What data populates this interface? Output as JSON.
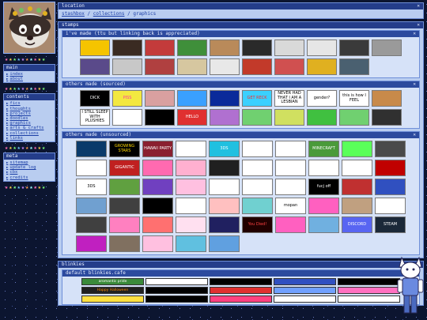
{
  "sidebar": {
    "sections": [
      {
        "title": "main",
        "items": [
          "index",
          "about"
        ]
      },
      {
        "title": "contents",
        "items": [
          "fics",
          "thoughts",
          "projects",
          "doodles",
          "graphics",
          "arts & crafts",
          "collections",
          "links"
        ]
      },
      {
        "title": "meta",
        "items": [
          "sitemap",
          "update log",
          "cbx",
          "credits"
        ]
      }
    ],
    "star_colors": [
      "#ff6fb5",
      "#ffd24a",
      "#7dff7a",
      "#6fc8ff",
      "#c98bff",
      "#ff9a4a",
      "#9affff",
      "#ff6fb5",
      "#ffd24a",
      "#7dff7a"
    ]
  },
  "location": {
    "title": "location",
    "crumbs": [
      "stashbox",
      "collections",
      "graphics"
    ],
    "sep": " / "
  },
  "stamps": {
    "title": "stamps",
    "made": {
      "title": "i've made (ttu but linking back is appreciated)",
      "colors": [
        "#f5c400",
        "#3a2b22",
        "#c33b3b",
        "#3f8f3a",
        "#b98a5a",
        "#2a2a2a",
        "#d9d9d9",
        "#e6e6e6",
        "#3a3a3a",
        "#9a9a9a",
        "#5a4a8a",
        "#c8c8c8",
        "#b04040",
        "#d6c7a0",
        "#e8e8e8",
        "#c23a2a",
        "#d05050",
        "#e0b020",
        "#4a6070"
      ],
      "labels": [
        "",
        "",
        "",
        "",
        "",
        "",
        "",
        "",
        "",
        "",
        "",
        "",
        "",
        "",
        "",
        "",
        "",
        "",
        ""
      ]
    },
    "others_sourced": {
      "title": "others made (sourced)",
      "items": [
        {
          "t": "DICK",
          "c": "#000000",
          "f": "#ffffff"
        },
        {
          "t": "PISS",
          "c": "#f3e840",
          "f": "#ff3aa0"
        },
        {
          "t": "",
          "c": "#d9a0a0",
          "f": "#fff"
        },
        {
          "t": "",
          "c": "#3aa0ff",
          "f": "#fff"
        },
        {
          "t": "",
          "c": "#0a2a9a",
          "f": "#ffd700"
        },
        {
          "t": "GET RECK",
          "c": "#3ad0ff",
          "f": "#ff2a2a"
        },
        {
          "t": "NEVER HAD THAT I AM A LESBIAN",
          "c": "#ffffff",
          "f": "#000"
        },
        {
          "t": "gender?",
          "c": "#ffffff",
          "f": "#000"
        },
        {
          "t": "this is how I FEEL",
          "c": "#ffffff",
          "f": "#000"
        },
        {
          "t": "",
          "c": "#c88a4a",
          "f": "#fff"
        },
        {
          "t": "I STILL SLEEP WITH PLUSHIES",
          "c": "#ffffff",
          "f": "#000"
        },
        {
          "t": "",
          "c": "#ffffff",
          "f": "#000"
        },
        {
          "t": "",
          "c": "#000000",
          "f": "#fff"
        },
        {
          "t": "HELLO",
          "c": "#e03030",
          "f": "#fff"
        },
        {
          "t": "",
          "c": "#b070d0",
          "f": "#fff"
        },
        {
          "t": "",
          "c": "#70d070",
          "f": "#fff"
        },
        {
          "t": "",
          "c": "#d0e060",
          "f": "#fff"
        },
        {
          "t": "",
          "c": "#40c040",
          "f": "#fff"
        },
        {
          "t": "",
          "c": "#70d070",
          "f": "#fff"
        },
        {
          "t": "",
          "c": "#303030",
          "f": "#fff"
        }
      ]
    },
    "others_unsourced": {
      "title": "others made (unsourced)",
      "items": [
        {
          "t": "",
          "c": "#0a3a6a",
          "f": "#fff"
        },
        {
          "t": "GROWING STARS",
          "c": "#000000",
          "f": "#ffd700"
        },
        {
          "t": "HAWAII PARTY",
          "c": "#8a2030",
          "f": "#fff"
        },
        {
          "t": "",
          "c": "#ffffff",
          "f": "#fff"
        },
        {
          "t": "3DS",
          "c": "#20c0e0",
          "f": "#fff"
        },
        {
          "t": "",
          "c": "#ffffff",
          "f": "#000"
        },
        {
          "t": "",
          "c": "#ffffff",
          "f": "#000"
        },
        {
          "t": "MINECRAFT",
          "c": "#4a9a3a",
          "f": "#fff"
        },
        {
          "t": "",
          "c": "#5aff5a",
          "f": "#000"
        },
        {
          "t": "",
          "c": "#4a4a4a",
          "f": "#fff"
        },
        {
          "t": "",
          "c": "#ffffff",
          "f": "#000"
        },
        {
          "t": "GIGANTIC",
          "c": "#c02020",
          "f": "#fff"
        },
        {
          "t": "",
          "c": "#ff6ab0",
          "f": "#fff"
        },
        {
          "t": "",
          "c": "#ffb0d0",
          "f": "#3a3aa0"
        },
        {
          "t": "",
          "c": "#202020",
          "f": "#fff"
        },
        {
          "t": "",
          "c": "#ffffff",
          "f": "#000"
        },
        {
          "t": "",
          "c": "#ffffff",
          "f": "#000"
        },
        {
          "t": "",
          "c": "#ffffff",
          "f": "#000"
        },
        {
          "t": "",
          "c": "#ffffff",
          "f": "#000"
        },
        {
          "t": "",
          "c": "#c00000",
          "f": "#fff"
        },
        {
          "t": "3DS",
          "c": "#ffffff",
          "f": "#000"
        },
        {
          "t": "",
          "c": "#60a040",
          "f": "#fff"
        },
        {
          "t": "",
          "c": "#7040c0",
          "f": "#fff"
        },
        {
          "t": "",
          "c": "#ffc0e0",
          "f": "#2a4ab0"
        },
        {
          "t": "",
          "c": "#ffffff",
          "f": "#000"
        },
        {
          "t": "",
          "c": "#ffffff",
          "f": "#000"
        },
        {
          "t": "",
          "c": "#ffffff",
          "f": "#000"
        },
        {
          "t": "fucj off",
          "c": "#000000",
          "f": "#fff"
        },
        {
          "t": "",
          "c": "#c03030",
          "f": "#fff"
        },
        {
          "t": "",
          "c": "#3050c0",
          "f": "#fff"
        },
        {
          "t": "",
          "c": "#70a0d0",
          "f": "#fff"
        },
        {
          "t": "",
          "c": "#404040",
          "f": "#fff"
        },
        {
          "t": "",
          "c": "#000000",
          "f": "#fff"
        },
        {
          "t": "",
          "c": "#ffffff",
          "f": "#000"
        },
        {
          "t": "",
          "c": "#ffc0c0",
          "f": "#fff"
        },
        {
          "t": "",
          "c": "#70d0d0",
          "f": "#fff"
        },
        {
          "t": "mopan",
          "c": "#ffffff",
          "f": "#000"
        },
        {
          "t": "",
          "c": "#ff60c0",
          "f": "#fff"
        },
        {
          "t": "",
          "c": "#c0a080",
          "f": "#fff"
        },
        {
          "t": "",
          "c": "#ffffff",
          "f": "#000"
        },
        {
          "t": "",
          "c": "#404040",
          "f": "#fff"
        },
        {
          "t": "",
          "c": "#ff80c0",
          "f": "#fff"
        },
        {
          "t": "",
          "c": "#ff7070",
          "f": "#fff"
        },
        {
          "t": "",
          "c": "#ffe0f0",
          "f": "#000"
        },
        {
          "t": "",
          "c": "#202060",
          "f": "#fff"
        },
        {
          "t": "You Died!",
          "c": "#200000",
          "f": "#ff4040"
        },
        {
          "t": "",
          "c": "#ff60c0",
          "f": "#fff"
        },
        {
          "t": "",
          "c": "#70b0e0",
          "f": "#fff"
        },
        {
          "t": "DISCORD",
          "c": "#5865f2",
          "f": "#fff"
        },
        {
          "t": "STEAM",
          "c": "#1b2838",
          "f": "#fff"
        },
        {
          "t": "",
          "c": "#c020c0",
          "f": "#fff"
        },
        {
          "t": "",
          "c": "#807060",
          "f": "#fff"
        },
        {
          "t": "",
          "c": "#ffc0e0",
          "f": "#000"
        },
        {
          "t": "",
          "c": "#60c0e0",
          "f": "#fff"
        },
        {
          "t": "",
          "c": "#60a0e0",
          "f": "#fff"
        }
      ]
    }
  },
  "blinkies": {
    "title": "blinkies",
    "sub": "default blinkies.cafe",
    "items": [
      {
        "t": "aromantic pride",
        "c": "#3a8a3a",
        "f": "#fff"
      },
      {
        "t": "",
        "c": "#ffffff",
        "f": "#000"
      },
      {
        "t": "",
        "c": "#000000",
        "f": "#fff"
      },
      {
        "t": "",
        "c": "#3050c0",
        "f": "#fff"
      },
      {
        "t": "",
        "c": "#000000",
        "f": "#7fff7f"
      },
      {
        "t": "Happy Halloween",
        "c": "#202020",
        "f": "#ff8a00"
      },
      {
        "t": "",
        "c": "#000000",
        "f": "#ff3a3a"
      },
      {
        "t": "",
        "c": "#e03030",
        "f": "#fff"
      },
      {
        "t": "",
        "c": "#70a0ff",
        "f": "#fff"
      },
      {
        "t": "",
        "c": "#ff70c0",
        "f": "#fff"
      },
      {
        "t": "",
        "c": "#ffe040",
        "f": "#000"
      },
      {
        "t": "",
        "c": "#000000",
        "f": "#fff"
      },
      {
        "t": "",
        "c": "#ff4080",
        "f": "#fff"
      },
      {
        "t": "",
        "c": "#ffffff",
        "f": "#000"
      },
      {
        "t": "",
        "c": "#ffffff",
        "f": "#000"
      }
    ]
  }
}
